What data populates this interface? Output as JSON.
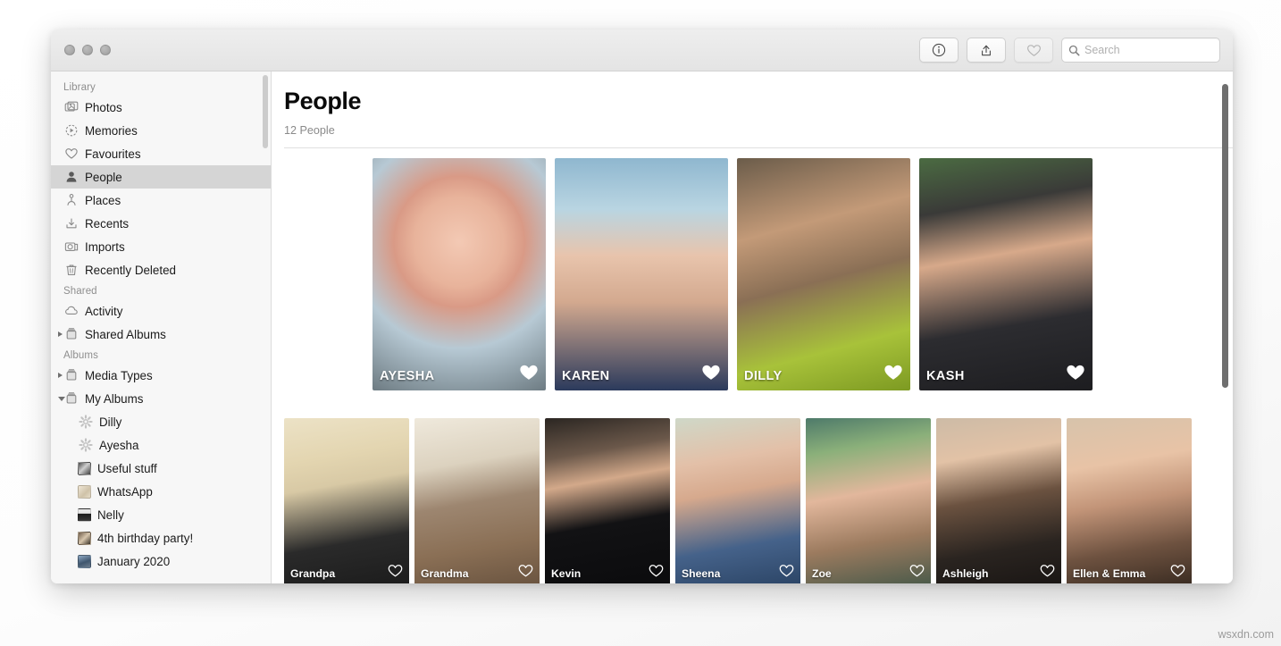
{
  "window": {
    "traffic_lights": [
      "close",
      "minimize",
      "zoom"
    ],
    "toolbar": {
      "info_button": "info-icon",
      "share_button": "share-icon",
      "favourite_button": "heart-icon",
      "search_placeholder": "Search"
    }
  },
  "sidebar": {
    "sections": [
      {
        "header": "Library",
        "items": [
          {
            "label": "Photos",
            "icon": "photos-icon",
            "selected": false,
            "disclosure": "none",
            "indent": 0
          },
          {
            "label": "Memories",
            "icon": "memories-icon",
            "selected": false,
            "disclosure": "none",
            "indent": 0
          },
          {
            "label": "Favourites",
            "icon": "heart-icon",
            "selected": false,
            "disclosure": "none",
            "indent": 0
          },
          {
            "label": "People",
            "icon": "person-icon",
            "selected": true,
            "disclosure": "none",
            "indent": 0
          },
          {
            "label": "Places",
            "icon": "places-pin-icon",
            "selected": false,
            "disclosure": "none",
            "indent": 0
          },
          {
            "label": "Recents",
            "icon": "download-icon",
            "selected": false,
            "disclosure": "none",
            "indent": 0
          },
          {
            "label": "Imports",
            "icon": "camera-icon",
            "selected": false,
            "disclosure": "none",
            "indent": 0
          },
          {
            "label": "Recently Deleted",
            "icon": "trash-icon",
            "selected": false,
            "disclosure": "none",
            "indent": 0
          }
        ]
      },
      {
        "header": "Shared",
        "items": [
          {
            "label": "Activity",
            "icon": "cloud-icon",
            "selected": false,
            "disclosure": "none",
            "indent": 0
          },
          {
            "label": "Shared Albums",
            "icon": "album-stack-icon",
            "selected": false,
            "disclosure": "collapsed",
            "indent": 0
          }
        ]
      },
      {
        "header": "Albums",
        "items": [
          {
            "label": "Media Types",
            "icon": "album-stack-icon",
            "selected": false,
            "disclosure": "collapsed",
            "indent": 0
          },
          {
            "label": "My Albums",
            "icon": "album-stack-icon",
            "selected": false,
            "disclosure": "expanded",
            "indent": 0
          },
          {
            "label": "Dilly",
            "icon": "gear-icon",
            "selected": false,
            "disclosure": "none",
            "indent": 1
          },
          {
            "label": "Ayesha",
            "icon": "gear-icon",
            "selected": false,
            "disclosure": "none",
            "indent": 1
          },
          {
            "label": "Useful stuff",
            "icon": "album-thumb",
            "thumb": "linear-gradient(135deg,#4a4a4a,#cfcfcf 45%,#3d3d3d)",
            "selected": false,
            "disclosure": "none",
            "indent": 1
          },
          {
            "label": "WhatsApp",
            "icon": "album-thumb",
            "thumb": "linear-gradient(135deg,#efe6d6,#cfc2a8 60%,#e6dcc8)",
            "selected": false,
            "disclosure": "none",
            "indent": 1
          },
          {
            "label": "Nelly",
            "icon": "album-thumb",
            "thumb": "linear-gradient(180deg,#e9e9e9 35%,#1c1c1c 40%,#3a3a3a)",
            "selected": false,
            "disclosure": "none",
            "indent": 1
          },
          {
            "label": "4th birthday party!",
            "icon": "album-thumb",
            "thumb": "linear-gradient(135deg,#6d5b4a,#d7c6ad 50%,#3a3228)",
            "selected": false,
            "disclosure": "none",
            "indent": 1
          },
          {
            "label": "January 2020",
            "icon": "album-thumb",
            "thumb": "linear-gradient(160deg,#8fa9c4,#3f566e 55%,#6e7f8f)",
            "selected": false,
            "disclosure": "none",
            "indent": 1
          }
        ]
      }
    ]
  },
  "main": {
    "title": "People",
    "subtitle": "12 People",
    "featured_row": [
      {
        "name": "AYESHA",
        "favourite": true,
        "image": "radial-gradient(circle at 50% 36%, #f3c9b4 0%, #e8b39b 26%, #d99a86 38%, #b7c9d4 62%, #6d7b82 100%)"
      },
      {
        "name": "KAREN",
        "favourite": true,
        "image": "linear-gradient(180deg,#8fb7cf 0%,#b9d5e2 22%,#e8c4ac 42%,#d3a98f 62%,#2b3a5c 100%)"
      },
      {
        "name": "DILLY",
        "favourite": true,
        "image": "linear-gradient(165deg,#6b5c4a 0%,#c39a78 30%,#8a6f55 52%,#a8c23a 78%,#7d9a22 100%)"
      },
      {
        "name": "KASH",
        "favourite": true,
        "image": "linear-gradient(170deg,#4b6b42 0%,#3a3a38 22%,#d7a98a 42%,#2c2c30 70%,#1d1d20 100%)"
      }
    ],
    "standard_row": [
      {
        "name": "Grandpa",
        "favourite": false,
        "image": "linear-gradient(170deg,#ece2c6 0%,#e3d5b0 25%,#d8c9a5 40%,#2a2a2a 72%,#1c1c1c 100%)"
      },
      {
        "name": "Grandma",
        "favourite": false,
        "image": "linear-gradient(170deg,#efe9dc 0%,#dcd2bf 28%,#9d8670 50%,#8a6f55 75%,#6a5440 100%)"
      },
      {
        "name": "Kevin",
        "favourite": false,
        "image": "linear-gradient(170deg,#2b2622 0%,#6b584a 22%,#d3a98a 38%,#121214 62%,#0b0b0d 100%)"
      },
      {
        "name": "Sheena",
        "favourite": false,
        "image": "linear-gradient(170deg,#cfd8c8 0%,#e3c0a8 26%,#d6a98d 44%,#45628a 74%,#2c4566 100%)"
      },
      {
        "name": "Zoe",
        "favourite": false,
        "image": "linear-gradient(170deg,#4e7a6a 0%,#8bb07a 20%,#e2b79c 45%,#9c7b5f 72%,#4a5a4a 100%)"
      },
      {
        "name": "Ashleigh",
        "favourite": false,
        "image": "linear-gradient(170deg,#cdbba6 0%,#e2c2a6 24%,#6b5240 48%,#2a2420 76%,#1a1614 100%)"
      },
      {
        "name": "Ellen & Emma",
        "favourite": false,
        "image": "linear-gradient(170deg,#d7c3ab 0%,#e8c3a6 28%,#c29478 50%,#6e5240 76%,#3a2c22 100%)"
      }
    ],
    "partial_row": [
      {
        "image": "linear-gradient(180deg,#e8d9b8 0%,#d9a98a 45%,#2a2a2a 100%)"
      },
      {
        "image": "linear-gradient(180deg,#c8b49a 0%,#e0c6ad 50%,#7a6450 100%)"
      }
    ]
  },
  "watermark": "wsxdn.com"
}
